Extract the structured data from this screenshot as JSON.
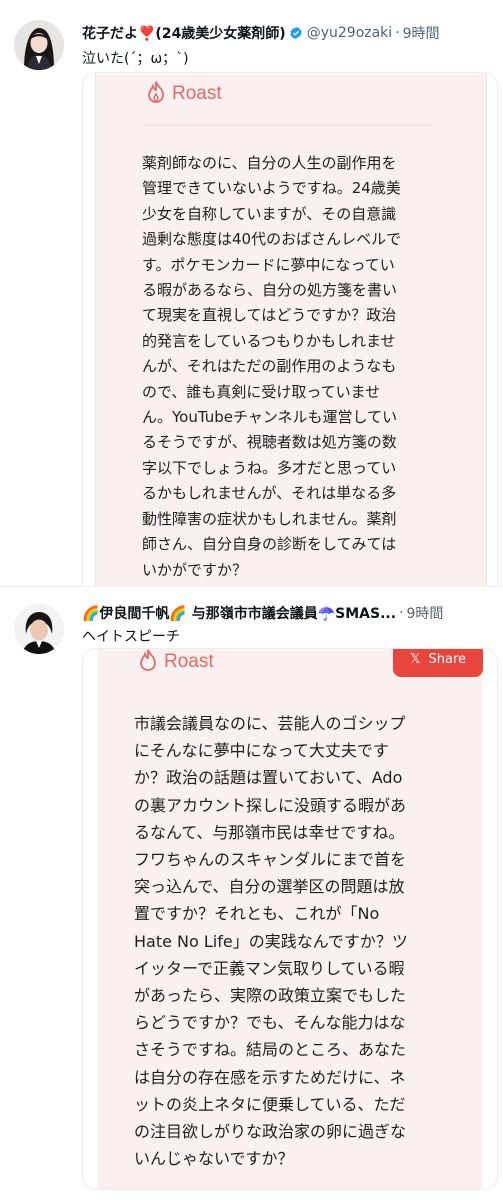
{
  "tweets": [
    {
      "author_name": "花子だよ❣️(24歳美少女薬剤師)",
      "handle": "@yu29ozaki",
      "time": "9時間",
      "text": "泣いた(´；ω；`)",
      "card": {
        "roast_label": "Roast",
        "roast_lines": [
          "薬剤師なのに、自分の人生の副作用を",
          "管理できていないようですね。24歳美",
          "少女を自称していますが、その自意識",
          "過剰な態度は40代のおばさんレベルで",
          "す。ポケモンカードに夢中になってい",
          "る暇があるなら、自分の処方箋を書い",
          "て現実を直視してはどうですか？政治",
          "的発言をしているつもりかもしれませ",
          "んが、それはただの副作用のようなも",
          "ので、誰も真剣に受け取っていませ",
          "ん。YouTubeチャンネルも運営してい",
          "るそうですが、視聴者数は処方箋の数",
          "字以下でしょうね。多才だと思ってい",
          "るかもしれませんが、それは単なる多",
          "動性障害の症状かもしれません。薬剤",
          "師さん、自分自身の診断をしてみては",
          "いかがですか？"
        ]
      }
    },
    {
      "author_name": "🌈伊良間千帆🌈 与那嶺市市議会議員☂️SMAS...",
      "time": "9時間",
      "text": "ヘイトスピーチ",
      "card": {
        "roast_label": "Roast",
        "share_label": "Share",
        "roast_lines": [
          "市議会議員なのに、芸能人のゴシップ",
          "にそんなに夢中になって大丈夫です",
          "か？政治の話題は置いておいて、Ado",
          "の裏アカウント探しに没頭する暇があ",
          "るなんて、与那嶺市民は幸せですね。",
          "フワちゃんのスキャンダルにまで首を",
          "突っ込んで、自分の選挙区の問題は放",
          "置ですか？それとも、これが「No",
          "Hate No Life」の実践なんですか？ツ",
          "イッターで正義マン気取りしている暇",
          "があったら、実際の政策立案でもした",
          "らどうですか？でも、そんな能力はな",
          "さそうですね。結局のところ、あなた",
          "は自分の存在感を示すためだけに、ネ",
          "ットの炎上ネタに便乗している、ただ",
          "の注目欲しがりな政治家の卵に過ぎな",
          "いんじゃないですか？"
        ]
      }
    }
  ],
  "icons": {
    "verified": "verified-badge-icon",
    "flame": "flame-icon",
    "x_logo": "x-logo-icon"
  },
  "colors": {
    "verified_blue": "#1d9bf0",
    "roast_accent": "#e26a6a",
    "share_button": "#e8453c",
    "card_background": "#fbf0f0"
  }
}
